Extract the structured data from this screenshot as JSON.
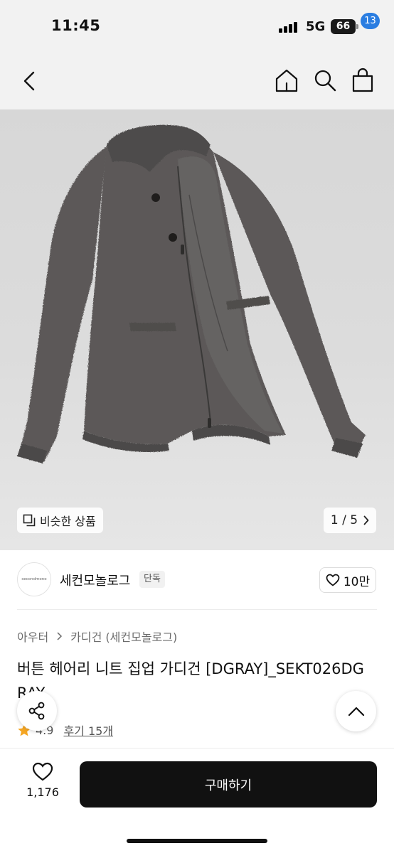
{
  "status_bar": {
    "time": "11:45",
    "network": "5G",
    "battery": "66"
  },
  "nav": {
    "cart_count": "13"
  },
  "gallery": {
    "similar_label": "비슷한 상품",
    "pager_text": "1 / 5",
    "garment_color": "#5b5958"
  },
  "shop": {
    "logo_text": "secondmono",
    "name": "세컨모놀로그",
    "badge": "단독",
    "likes": "10만"
  },
  "breadcrumb": {
    "category": "아우터",
    "subcategory": "카디건 (세컨모놀로그)"
  },
  "product": {
    "title": "버튼 헤어리 니트 집업 가디건 [DGRAY]_SEKT026DGRAY",
    "rating": "4.9",
    "reviews_label": "후기 15개"
  },
  "bottom_bar": {
    "wish_count": "1,176",
    "buy_label": "구매하기"
  },
  "colors": {
    "accent_badge": "#2a7de1",
    "buy_button": "#111111",
    "star": "#f5a623"
  }
}
